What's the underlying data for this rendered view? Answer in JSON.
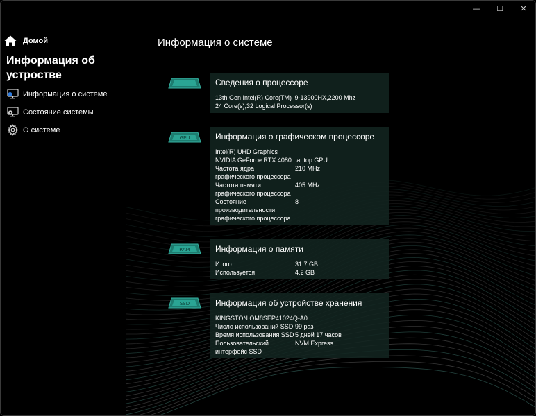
{
  "window_controls": {
    "minimize": "—",
    "maximize": "☐",
    "close": "✕"
  },
  "sidebar": {
    "home_label": "Домой",
    "section_title": "Информация об устростве",
    "items": [
      {
        "label": "Информация о системе"
      },
      {
        "label": "Состояние системы"
      },
      {
        "label": "О системе"
      }
    ]
  },
  "main": {
    "title": "Информация о системе",
    "cards": {
      "cpu": {
        "icon_text": "",
        "title": "Сведения о процессоре",
        "lines": [
          "13th Gen Intel(R) Core(TM) i9-13900HX,2200 Mhz",
          "24 Core(s),32 Logical Processor(s)"
        ]
      },
      "gpu": {
        "icon_text": "GPU",
        "title": "Информация о графическом процессоре",
        "lines": [
          "Intel(R) UHD Graphics",
          "NVIDIA GeForce RTX 4080 Laptop GPU"
        ],
        "rows": [
          {
            "key": "Частота ядра графического процессора",
            "value": "210 MHz"
          },
          {
            "key": "Частота памяти графического процессора",
            "value": "405 MHz"
          },
          {
            "key": "Состояние производительности графического процессора",
            "value": "8"
          }
        ]
      },
      "memory": {
        "icon_text": "RAM",
        "title": "Информация о памяти",
        "rows": [
          {
            "key": "Итого",
            "value": "31.7 GB"
          },
          {
            "key": "Используется",
            "value": "4.2 GB"
          }
        ]
      },
      "storage": {
        "icon_text": "SSD",
        "title": "Информация об устройстве хранения",
        "lines": [
          "KINGSTON OM8SEP41024Q-A0"
        ],
        "rows": [
          {
            "key": "Число использований SSD",
            "value": "99 раз"
          },
          {
            "key": "Время использования SSD",
            "value": "5 дней 17 часов"
          },
          {
            "key": "Пользовательский интерфейс SSD",
            "value": "NVM Express"
          }
        ]
      }
    }
  },
  "colors": {
    "background": "#000000",
    "card_background": "#122420",
    "accent_teal": "#2fa89a"
  }
}
